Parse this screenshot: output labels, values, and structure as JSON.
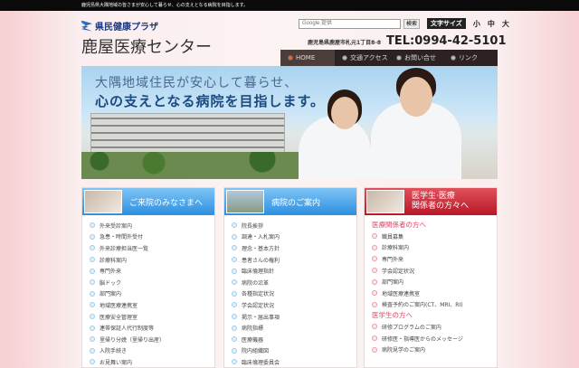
{
  "topbar": {
    "text": "鹿児島県大隅地域の皆さまが安心して暮らせ、心の支えとなる病院を目指します。"
  },
  "logo": {
    "sub": "県民健康プラザ",
    "main": "鹿屋医療センター"
  },
  "search": {
    "placeholder": "Google 提供",
    "button": "検索"
  },
  "font_size": {
    "label": "文字サイズ",
    "small": "小",
    "medium": "中",
    "large": "大"
  },
  "address": "鹿児島県鹿屋市札元1丁目8-8",
  "tel": "TEL:0994-42-5101",
  "nav": [
    {
      "label": "HOME"
    },
    {
      "label": "交通アクセス"
    },
    {
      "label": "お問い合せ"
    },
    {
      "label": "リンク"
    }
  ],
  "hero": {
    "line1": "大隅地域住民が安心して暮らせ、",
    "line2": "心の支えとなる病院を目指します。"
  },
  "columns": {
    "visitors": {
      "title": "ご来院のみなさまへ",
      "items": [
        "外来受診案内",
        "急患・時間外受付",
        "外来診療担当医一覧",
        "診療科案内",
        "専門外来",
        "脳ドック",
        "部門案内",
        "地域医療連携室",
        "医療安全管理室",
        "連帯保証人代行制度等",
        "里帰り分娩（里帰り出産）",
        "入院手続き",
        "お見舞い案内"
      ]
    },
    "hospital": {
      "title": "病院のご案内",
      "items": [
        "院長挨拶",
        "調達・入札案内",
        "理念・基本方針",
        "患者さんの権利",
        "臨床倫理指針",
        "病院の沿革",
        "各種指定状況",
        "学会認定状況",
        "掲示・届出事項",
        "病院指標",
        "医療機器",
        "院内組織図",
        "臨床倫理委員会"
      ]
    },
    "professionals": {
      "title1": "医学生·医療",
      "title2": "関係者の方々へ",
      "section1": "医療関係者の方へ",
      "items1": [
        "職員募集",
        "診療科案内",
        "専門外来",
        "学会認定状況",
        "部門案内",
        "地域医療連携室",
        "検査予約のご案内(CT、MRI、RI)"
      ],
      "section2": "医学生の方へ",
      "items2": [
        "研修プログラムのご案内",
        "研修医・指導医からのメッセージ",
        "病院見学のご案内"
      ]
    }
  }
}
